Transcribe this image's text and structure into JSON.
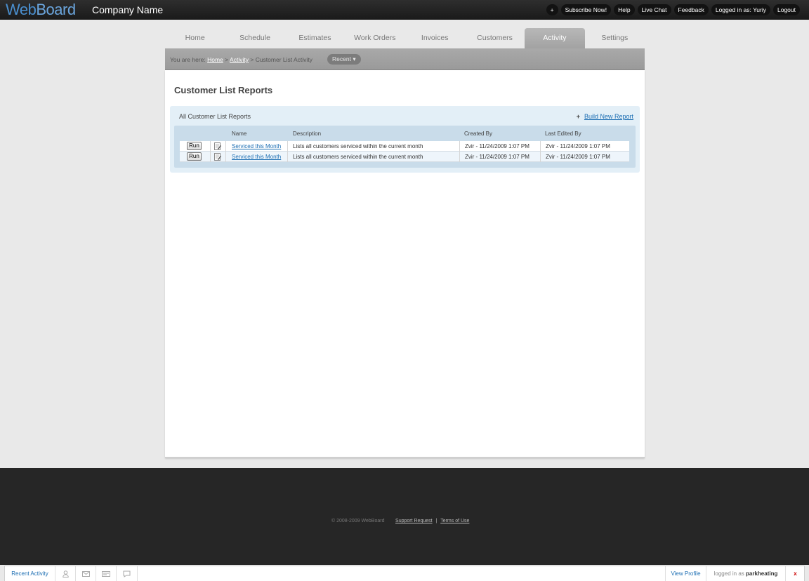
{
  "app": {
    "logo": {
      "part1": "Web",
      "part2": "Board"
    },
    "company_name": "Company Name"
  },
  "top_links": [
    "+",
    "Subscribe Now!",
    "Help",
    "Live Chat",
    "Feedback",
    "Logged in as: Yuriy",
    "Logout"
  ],
  "tabs": [
    "Home",
    "Schedule",
    "Estimates",
    "Work Orders",
    "Invoices",
    "Customers",
    "Activity",
    "Settings"
  ],
  "active_tab": "Activity",
  "breadcrumb": {
    "prefix": "You are here:",
    "home": "Home",
    "activity": "Activity",
    "current": "Customer List Activity",
    "recent_label": "Recent"
  },
  "page": {
    "title": "Customer List Reports",
    "panel_title": "All Customer List Reports",
    "build_link_icon": "+",
    "build_link": "Build New Report"
  },
  "table": {
    "headers": {
      "name": "Name",
      "description": "Description",
      "created_by": "Created By",
      "last_edited_by": "Last Edited By"
    },
    "run_label": "Run",
    "rows": [
      {
        "name": "Serviced this Month",
        "description": "Lists all customers serviced within the current month",
        "created_by": "Zvir - 11/24/2009 1:07 PM",
        "last_edited_by": "Zvir - 11/24/2009 1:07 PM"
      },
      {
        "name": "Serviced this Month",
        "description": "Lists all customers serviced within the current month",
        "created_by": "Zvir - 11/24/2009 1:07 PM",
        "last_edited_by": "Zvir - 11/24/2009 1:07 PM"
      }
    ]
  },
  "footer": {
    "copyright": "© 2008-2009 WebBoard",
    "support": "Support Request",
    "divider": "|",
    "terms": "Terms of Use"
  },
  "bottom_bar": {
    "recent_activity": "Recent Activity",
    "icons": [
      "user-icon",
      "mail-icon",
      "card-icon",
      "chat-icon"
    ],
    "view_profile": "View Profile",
    "logged_prefix": "logged in as",
    "logged_user": "parkheating",
    "close": "x"
  },
  "colors": {
    "accent": "#1c6eb3",
    "logo": "#4a8fcf",
    "panel": "#e3eff7",
    "topbar": "#1b1b1b",
    "footer": "#262626"
  }
}
